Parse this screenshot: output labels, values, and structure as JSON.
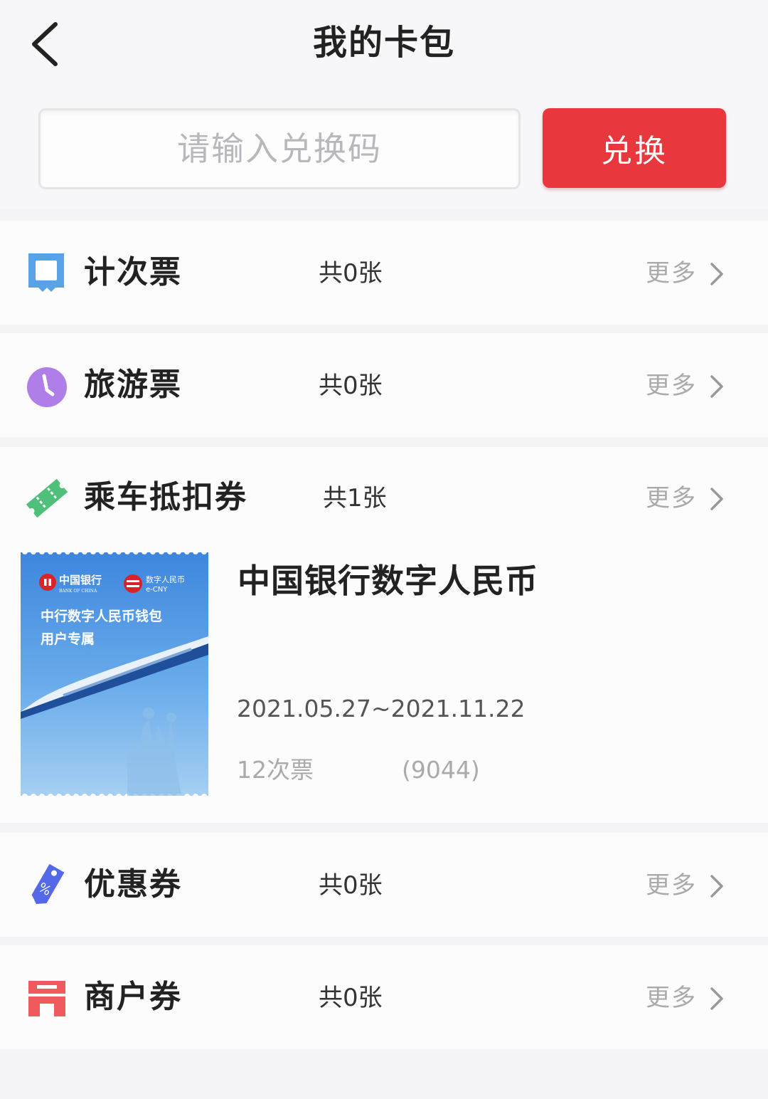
{
  "header": {
    "title": "我的卡包"
  },
  "redeem": {
    "placeholder": "请输入兑换码",
    "value": "",
    "button_label": "兑换"
  },
  "categories": [
    {
      "name": "计次票",
      "count": "共0张",
      "more": "更多",
      "icon": "ticket-icon"
    },
    {
      "name": "旅游票",
      "count": "共0张",
      "more": "更多",
      "icon": "clock-icon"
    },
    {
      "name": "乘车抵扣券",
      "count": "共1张",
      "more": "更多",
      "icon": "ride-coupon-icon"
    },
    {
      "name": "优惠券",
      "count": "共0张",
      "more": "更多",
      "icon": "discount-tag-icon"
    },
    {
      "name": "商户券",
      "count": "共0张",
      "more": "更多",
      "icon": "store-icon"
    }
  ],
  "ticket": {
    "title": "中国银行数字人民币",
    "date_range": "2021.05.27~2021.11.22",
    "kind": "12次票",
    "code": "(9044)",
    "image": {
      "bank_name": "中国银行",
      "bank_name_en": "BANK OF CHINA",
      "ecny_label": "数字人民币",
      "ecny_sub": "e-CNY",
      "promo_line1": "中行数字人民币钱包",
      "promo_line2": "用户专属"
    }
  },
  "colors": {
    "accent_red": "#e8373d",
    "ticket_blue": "#5aa2e6",
    "tour_purple": "#b07ee8",
    "ride_green": "#4ec07a",
    "discount_blue": "#5569e8",
    "store_red": "#ef5a5e"
  }
}
